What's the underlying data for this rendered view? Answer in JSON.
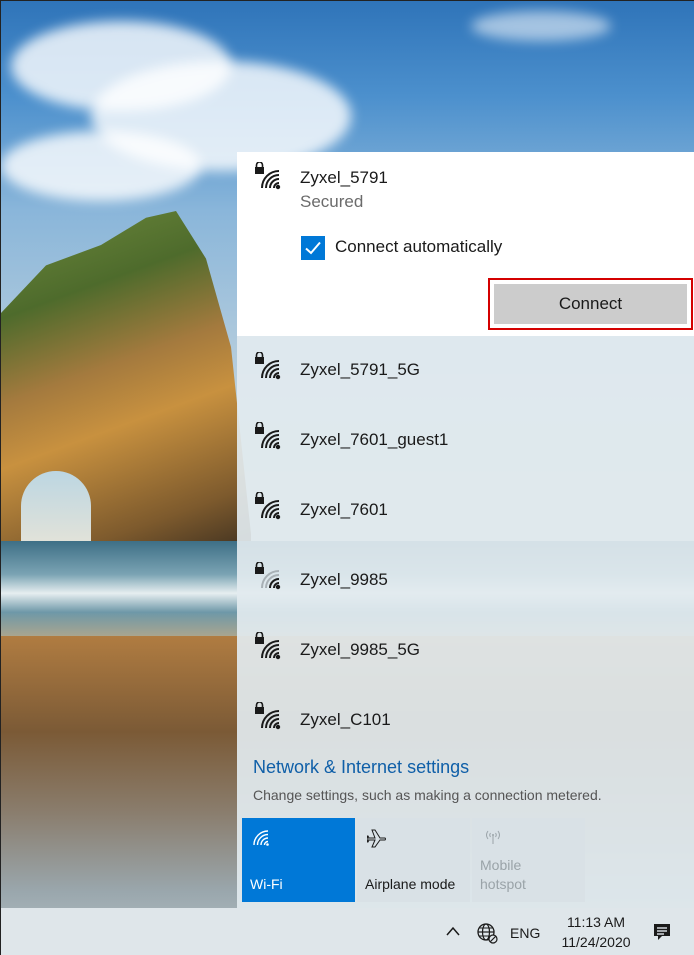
{
  "flyout": {
    "selected_network": {
      "ssid": "Zyxel_5791",
      "status": "Secured",
      "auto_connect_label": "Connect automatically",
      "auto_connect_checked": true,
      "connect_label": "Connect",
      "icon": "wifi-secured-icon"
    },
    "networks": [
      {
        "ssid": "Zyxel_5791_5G",
        "icon": "wifi-secured-icon"
      },
      {
        "ssid": "Zyxel_7601_guest1",
        "icon": "wifi-secured-icon"
      },
      {
        "ssid": "Zyxel_7601",
        "icon": "wifi-secured-icon"
      },
      {
        "ssid": "Zyxel_9985",
        "icon": "wifi-secured-weak-icon"
      },
      {
        "ssid": "Zyxel_9985_5G",
        "icon": "wifi-secured-icon"
      },
      {
        "ssid": "Zyxel_C101",
        "icon": "wifi-secured-icon"
      }
    ],
    "settings_link": "Network & Internet settings",
    "settings_description": "Change settings, such as making a connection metered.",
    "quick_actions": [
      {
        "label": "Wi-Fi",
        "icon": "wifi-icon",
        "active": true
      },
      {
        "label": "Airplane mode",
        "icon": "airplane-icon",
        "active": false
      },
      {
        "label_line1": "Mobile",
        "label_line2": "hotspot",
        "icon": "hotspot-icon",
        "active": false,
        "disabled": true
      }
    ]
  },
  "taskbar": {
    "language": "ENG",
    "time": "11:13 AM",
    "date": "11/24/2020",
    "icons": [
      "chevron-up-icon",
      "globe-icon",
      "notification-icon"
    ]
  },
  "colors": {
    "accent": "#0078d7",
    "highlight_border": "#d40000",
    "link": "#0f5fa8"
  }
}
